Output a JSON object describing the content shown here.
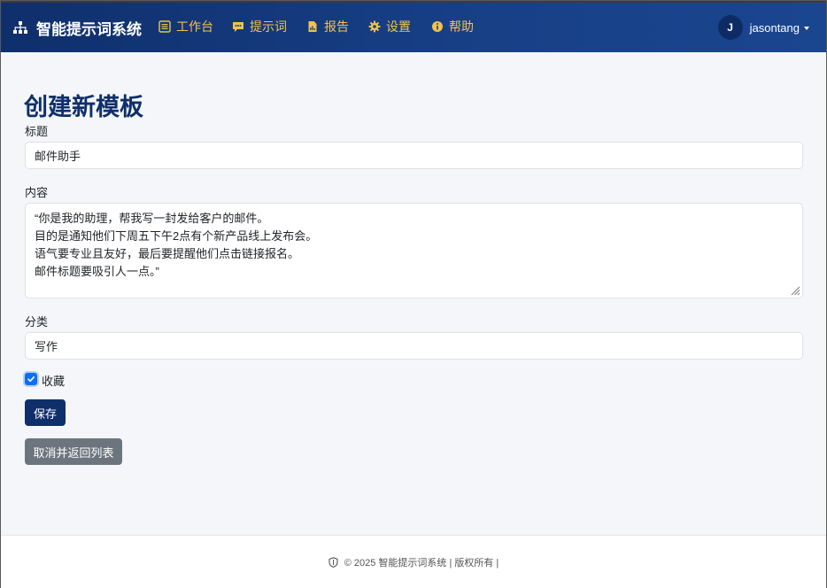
{
  "brand": {
    "title": "智能提示词系统",
    "icon": "sitemap-icon"
  },
  "nav": {
    "items": [
      {
        "label": "工作台",
        "icon": "list-alt-icon"
      },
      {
        "label": "提示词",
        "icon": "comment-dots-icon"
      },
      {
        "label": "报告",
        "icon": "file-chart-icon"
      },
      {
        "label": "设置",
        "icon": "gear-icon"
      },
      {
        "label": "帮助",
        "icon": "info-circle-icon"
      }
    ],
    "accent_color": "#f2c24b"
  },
  "user": {
    "initial": "J",
    "name": "jasontang"
  },
  "page": {
    "title": "创建新模板"
  },
  "form": {
    "title_label": "标题",
    "title_value": "邮件助手",
    "content_label": "内容",
    "content_lines": [
      "“你是我的助理，帮我写一封发给客户的邮件。",
      "目的是通知他们下周五下午2点有个新产品线上发布会。",
      "语气要专业且友好，最后要提醒他们点击链接报名。",
      "邮件标题要吸引人一点。”"
    ],
    "category_label": "分类",
    "category_value": "写作",
    "favorite_label": "收藏",
    "favorite_checked": true,
    "save_label": "保存",
    "cancel_label": "取消并返回列表"
  },
  "footer": {
    "text": "© 2025 智能提示词系统 | 版权所有 |"
  }
}
